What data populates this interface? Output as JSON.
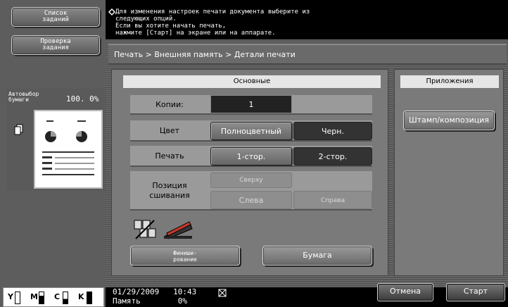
{
  "sidebar": {
    "job_list_label": "Список\nзаданий",
    "check_job_label": "Проверка\nзадания",
    "paper_label": "Автовыбор\nбумаги",
    "zoom": "100. 0%"
  },
  "message": "Для изменения настроек печати документа выберите из\nследующих опций.\nЕсли вы хотите начать печать,\nнажмите [Старт] на экране или на аппарате.",
  "breadcrumb": "Печать > Внешняя память > Детали печати",
  "basic": {
    "title": "Основные",
    "copies_label": "Копии:",
    "copies_value": "1",
    "color_label": "Цвет",
    "color_options": [
      "Полноцветный",
      "Черн."
    ],
    "color_selected": "Черн.",
    "print_label": "Печать",
    "print_options": [
      "1-стор.",
      "2-стор."
    ],
    "print_selected": "2-стор.",
    "binding_label": "Позиция\nсшивания",
    "binding_top": "Сверху",
    "binding_left": "Слева",
    "binding_right": "Справа",
    "finishing_label": "Финиши-\nрование",
    "paper_label": "Бумага"
  },
  "apps": {
    "title": "Приложения",
    "stamp_label": "Штамп/композиция"
  },
  "status": {
    "datetime": "01/29/2009   10:43",
    "memory": "Память        0%",
    "cancel_label": "Отмена",
    "start_label": "Старт"
  },
  "toner": [
    "Y",
    "M",
    "C",
    "K"
  ]
}
